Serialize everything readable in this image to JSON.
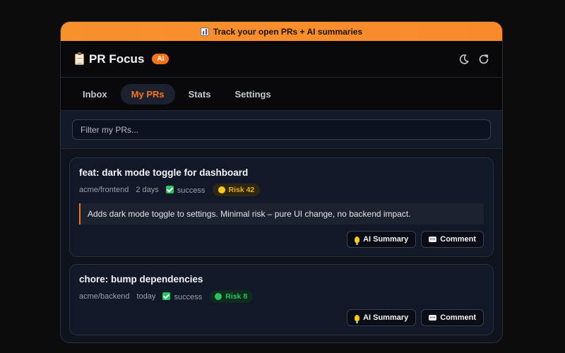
{
  "banner": {
    "text": "Track your open PRs + AI summaries"
  },
  "header": {
    "title": "PR Focus",
    "badge": "AI"
  },
  "tabs": [
    {
      "label": "Inbox",
      "active": false
    },
    {
      "label": "My PRs",
      "active": true
    },
    {
      "label": "Stats",
      "active": false
    },
    {
      "label": "Settings",
      "active": false
    }
  ],
  "filter": {
    "placeholder": "Filter my PRs...",
    "value": ""
  },
  "prs": [
    {
      "title": "feat: dark mode toggle for dashboard",
      "repo": "acme/frontend",
      "age": "2 days",
      "status": "success",
      "risk": "Risk 42",
      "risk_level": "medium",
      "summary": "Adds dark mode toggle to settings. Minimal risk – pure UI change, no backend impact.",
      "ai_summary_label": "AI Summary",
      "comment_label": "Comment"
    },
    {
      "title": "chore: bump dependencies",
      "repo": "acme/backend",
      "age": "today",
      "status": "success",
      "risk": "Risk 8",
      "risk_level": "low",
      "ai_summary_label": "AI Summary",
      "comment_label": "Comment"
    }
  ],
  "colors": {
    "accent": "#f97316",
    "banner": "#f7912b",
    "background": "#0c0c0d",
    "panel": "#0f131c",
    "risk_medium": "#eab308",
    "risk_low": "#22c55e"
  },
  "icons": {
    "banner": "bar-chart-icon",
    "brand": "clipboard-icon",
    "theme": "moon-icon",
    "refresh": "refresh-icon",
    "status": "checkmark-icon",
    "ai_summary": "lightbulb-icon",
    "comment": "speech-bubble-icon"
  }
}
